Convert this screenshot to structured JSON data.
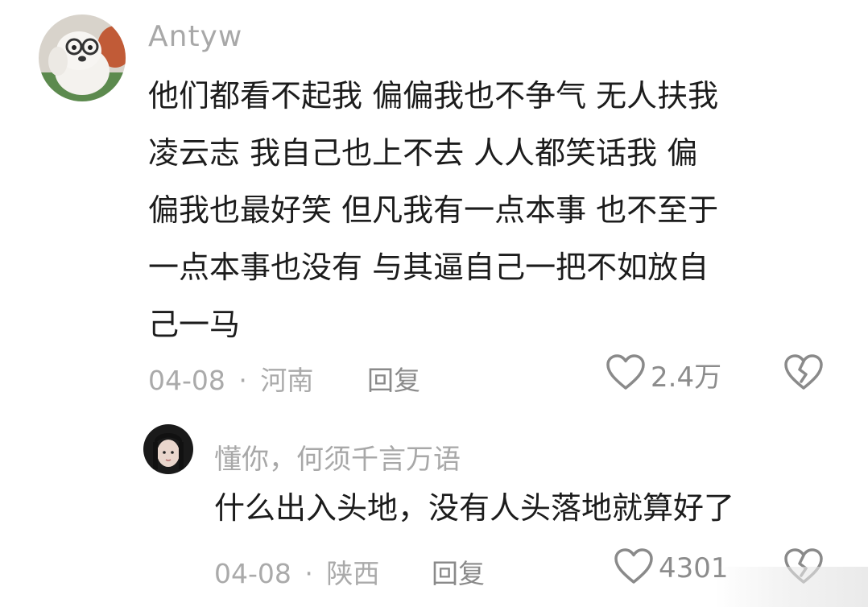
{
  "comment": {
    "username": "Antyw",
    "text_lines": [
      "他们都看不起我 偏偏我也不争气 无人扶我",
      "凌云志 我自己也上不去 人人都笑话我 偏",
      "偏我也最好笑 但凡我有一点本事 也不至于",
      "一点本事也没有 与其逼自己一把不如放自",
      "己一马"
    ],
    "date": "04-08",
    "separator": "·",
    "location": "河南",
    "reply_label": "回复",
    "like_count": "2.4万"
  },
  "reply": {
    "username": "懂你，何须千言万语",
    "text": "什么出入头地，没有人头落地就算好了",
    "date": "04-08",
    "separator": "·",
    "location": "陕西",
    "reply_label": "回复",
    "like_count": "4301"
  },
  "colors": {
    "text_primary": "#1c1c1c",
    "text_secondary": "#a8a8a8",
    "icon": "#8a8a8a"
  },
  "icons": {
    "like": "heart-icon",
    "dislike": "broken-heart-icon"
  }
}
